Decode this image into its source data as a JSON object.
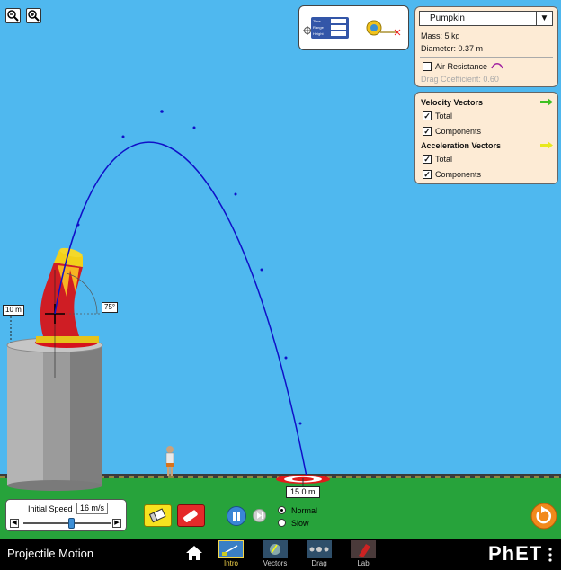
{
  "app": {
    "title": "Projectile Motion",
    "brand": "PhET"
  },
  "nav": {
    "screens": [
      {
        "label": "Intro",
        "active": true
      },
      {
        "label": "Vectors",
        "active": false
      },
      {
        "label": "Drag",
        "active": false
      },
      {
        "label": "Lab",
        "active": false
      }
    ]
  },
  "projectile_panel": {
    "selected": "Pumpkin",
    "mass": "Mass: 5 kg",
    "diameter": "Diameter: 0.37 m",
    "air_resistance_label": "Air Resistance",
    "air_resistance_checked": false,
    "drag_coefficient": "Drag Coefficient: 0.60"
  },
  "vectors_panel": {
    "velocity_title": "Velocity Vectors",
    "velocity_total": "Total",
    "velocity_components": "Components",
    "acceleration_title": "Acceleration Vectors",
    "acceleration_total": "Total",
    "acceleration_components": "Components",
    "velocity_arrow_color": "#3fbf22",
    "acceleration_arrow_color": "#e8e81e"
  },
  "measure_tools": {
    "row1": "Time",
    "row2": "Range",
    "row3": "Height"
  },
  "scene": {
    "height_label": "10 m",
    "angle_label": "75°",
    "target_distance": "15.0 m",
    "sky_color": "#4fb8ef",
    "ground_color": "#27a33b",
    "trajectory_color": "#1010c8"
  },
  "speed_control": {
    "label": "Initial Speed",
    "value": "16 m/s",
    "fraction": 0.55
  },
  "playback": {
    "normal_label": "Normal",
    "slow_label": "Slow",
    "selected": "Normal"
  }
}
